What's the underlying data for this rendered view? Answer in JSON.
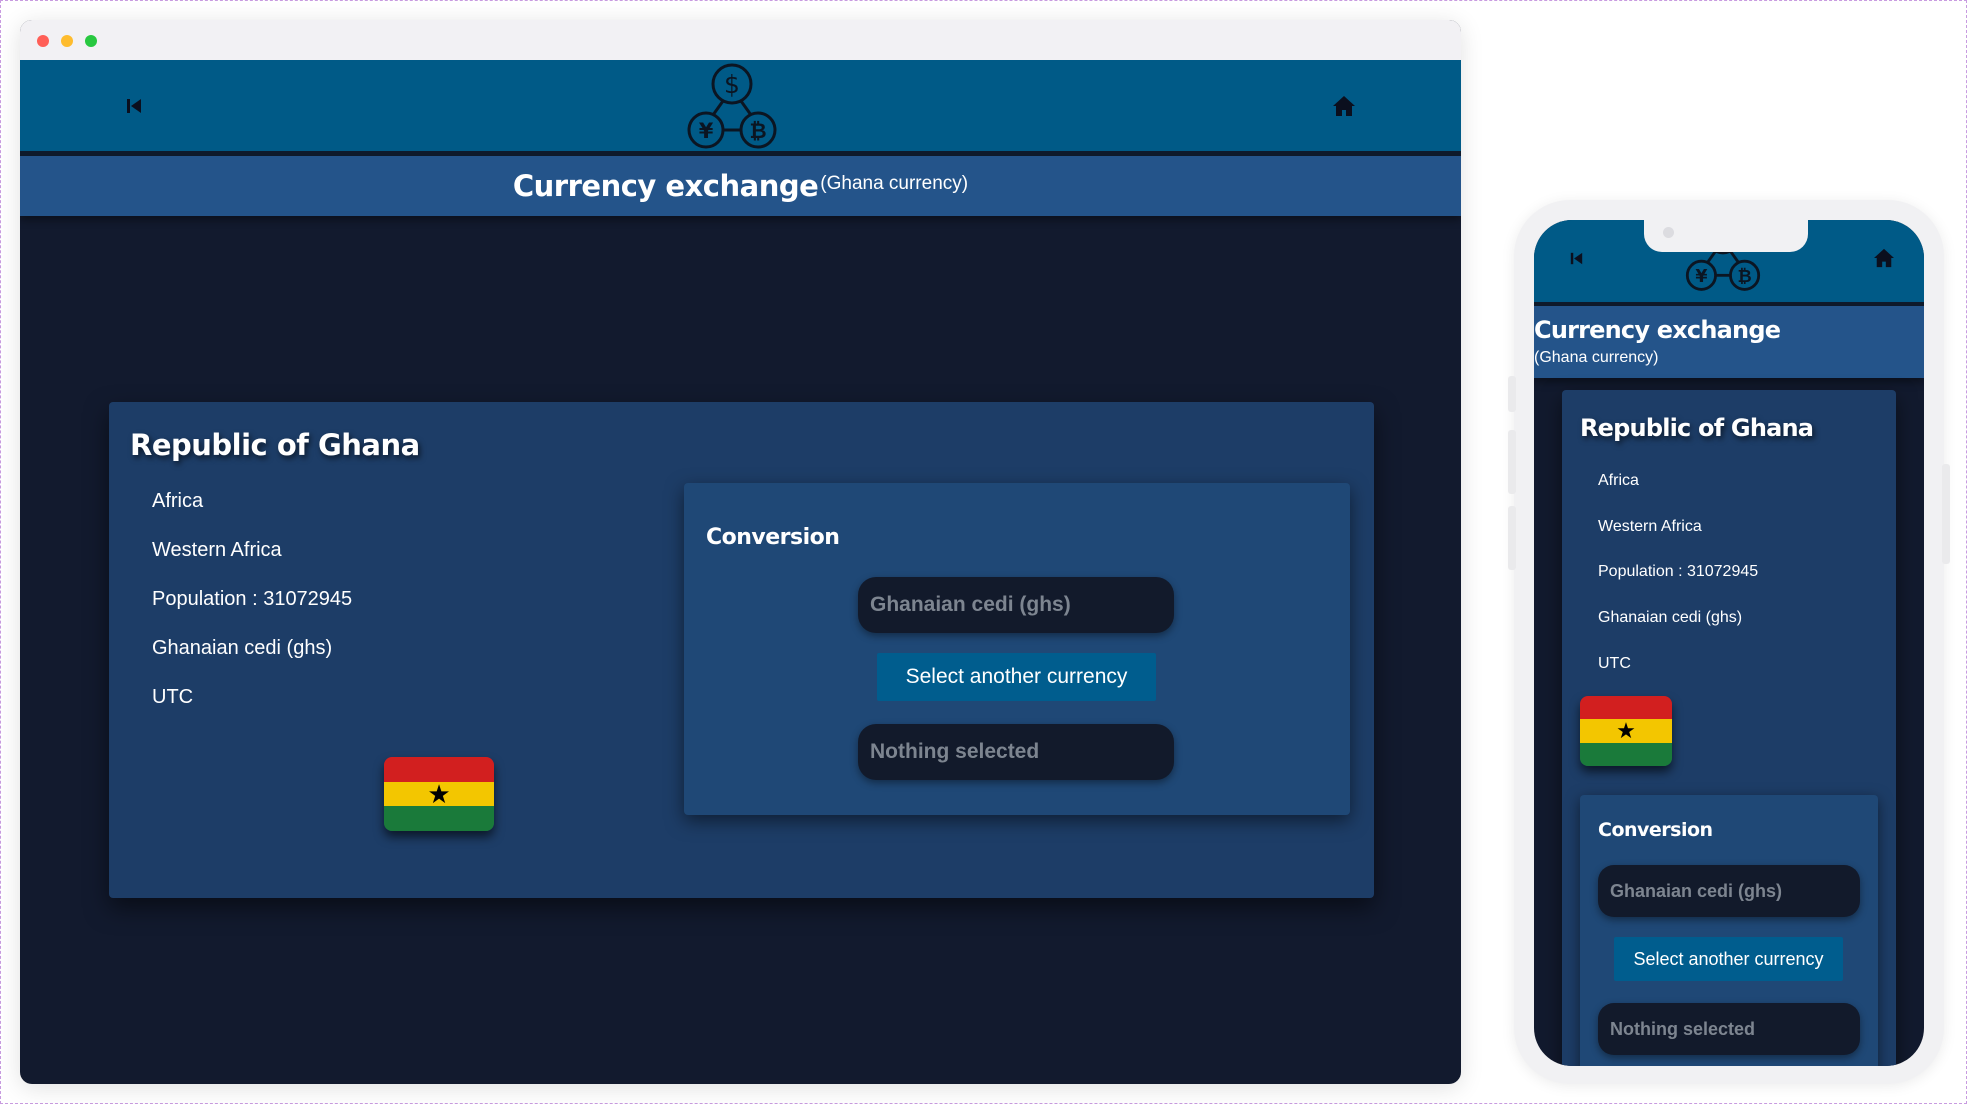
{
  "header": {
    "title": "Currency exchange",
    "subtitle": "(Ghana currency)",
    "back_icon": "skip-back-icon",
    "home_icon": "home-icon",
    "logo_icon": "currency-exchange-logo"
  },
  "country": {
    "name": "Republic of Ghana",
    "region": "Africa",
    "subregion": "Western Africa",
    "population": "Population : 31072945",
    "currency": "Ghanaian cedi (ghs)",
    "timezone": "UTC",
    "flag_icon": "ghana-flag"
  },
  "conversion": {
    "title": "Conversion",
    "from_currency": "Ghanaian cedi (ghs)",
    "select_button": "Select another currency",
    "result": "Nothing selected"
  },
  "colors": {
    "background": "#121a2e",
    "header": "#005a87",
    "titlebar": "#24548a",
    "card": "#1d3d67",
    "button": "#005d8e"
  }
}
